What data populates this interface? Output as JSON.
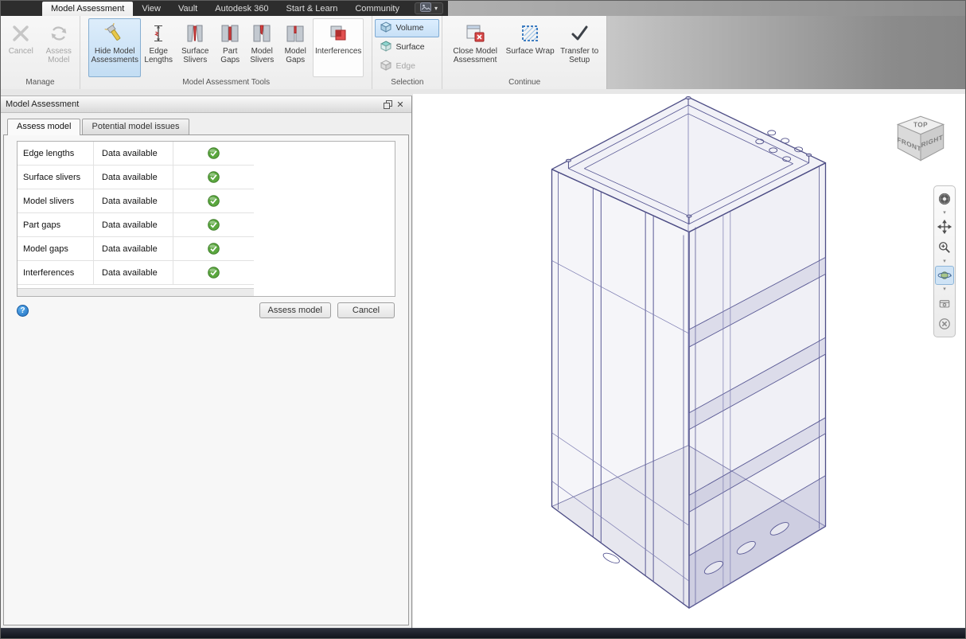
{
  "tabbar": {
    "tabs": [
      "Model Assessment",
      "View",
      "Vault",
      "Autodesk 360",
      "Start & Learn",
      "Community"
    ]
  },
  "ribbon": {
    "manage": {
      "label": "Manage",
      "cancel": "Cancel",
      "assess_model": "Assess Model"
    },
    "tools": {
      "label": "Model Assessment Tools",
      "hide_model_assessments": "Hide Model Assessments",
      "edge_lengths": "Edge Lengths",
      "surface_slivers": "Surface Slivers",
      "part_gaps": "Part Gaps",
      "model_slivers": "Model Slivers",
      "model_gaps": "Model Gaps",
      "interferences": "Interferences"
    },
    "selection": {
      "label": "Selection",
      "volume": "Volume",
      "surface": "Surface",
      "edge": "Edge"
    },
    "continue": {
      "label": "Continue",
      "close_model_assessment": "Close Model Assessment",
      "surface_wrap": "Surface Wrap",
      "transfer_to_setup": "Transfer to Setup"
    }
  },
  "panel": {
    "title": "Model Assessment",
    "tabs": {
      "assess": "Assess model",
      "issues": "Potential model issues"
    },
    "table": {
      "rows": [
        {
          "name": "Edge lengths",
          "status": "Data available"
        },
        {
          "name": "Surface slivers",
          "status": "Data available"
        },
        {
          "name": "Model slivers",
          "status": "Data available"
        },
        {
          "name": "Part gaps",
          "status": "Data available"
        },
        {
          "name": "Model gaps",
          "status": "Data available"
        },
        {
          "name": "Interferences",
          "status": "Data available"
        }
      ]
    },
    "buttons": {
      "assess": "Assess model",
      "cancel": "Cancel"
    }
  },
  "viewport": {
    "viewcube": {
      "top": "TOP",
      "front": "FRONT",
      "right": "RIGHT"
    }
  },
  "icons": {
    "caret_down": "▾",
    "close": "✕",
    "help": "?"
  },
  "colors": {
    "highlight_fill": "#cde3f6",
    "highlight_border": "#7fabd3",
    "check_green": "#5aa73e",
    "error_red": "#d84040",
    "wireframe": "#44447e"
  }
}
